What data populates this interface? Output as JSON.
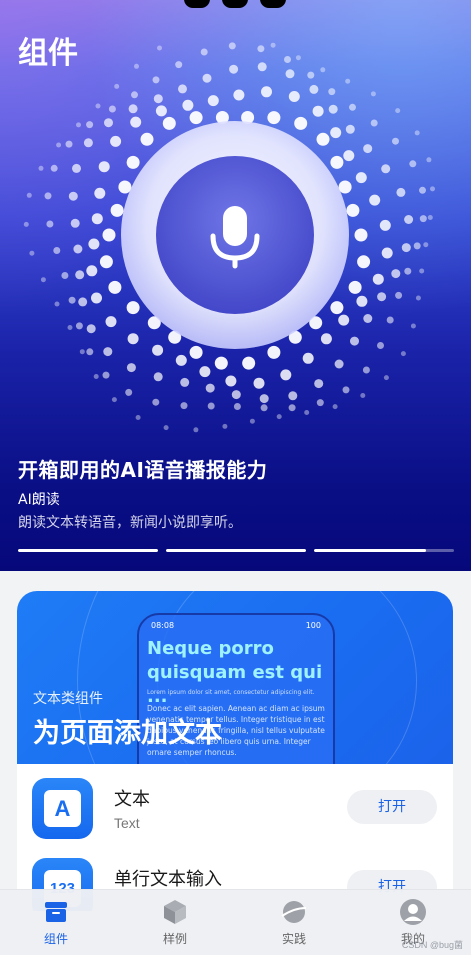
{
  "page": {
    "title": "组件"
  },
  "hero": {
    "headline": "开箱即用的AI语音播报能力",
    "subtitle": "AI朗读",
    "description": "朗读文本转语音，新闻小说即享听。",
    "mic_icon": "microphone-icon",
    "indicators": [
      {
        "progress": 1.0
      },
      {
        "progress": 1.0
      },
      {
        "progress": 0.8
      }
    ]
  },
  "card": {
    "banner": {
      "category": "文本类组件",
      "title": "为页面添加文本",
      "preview": {
        "time": "08:08",
        "status": "100",
        "heading": "Neque porro quisquam est qui ...",
        "small_text": "Lorem ipsum dolor sit amet, consectetur adipiscing elit.",
        "body_text": "Donec ac elit sapien. Aenean ac diam ac ipsum venenatis tempor tellus. Integer tristique in est dapibus venenatis fringilla, nisl tellus vulputate justo, at cursus leo libero quis urna. Integer ornare semper rhoncus."
      }
    },
    "items": [
      {
        "title": "文本",
        "subtitle": "Text",
        "icon_glyph": "A",
        "button": "打开"
      },
      {
        "title": "单行文本输入",
        "subtitle": "",
        "icon_glyph": "123",
        "button": "打开"
      }
    ]
  },
  "tabbar": {
    "tabs": [
      {
        "label": "组件",
        "icon": "components-icon",
        "active": true
      },
      {
        "label": "样例",
        "icon": "cube-icon",
        "active": false
      },
      {
        "label": "实践",
        "icon": "planet-icon",
        "active": false
      },
      {
        "label": "我的",
        "icon": "profile-icon",
        "active": false
      }
    ],
    "watermark": "CSDN @bug菌"
  },
  "colors": {
    "accent": "#1a62e6",
    "hero_dark": "#06087a",
    "banner_blue": "#1f7cf6"
  }
}
